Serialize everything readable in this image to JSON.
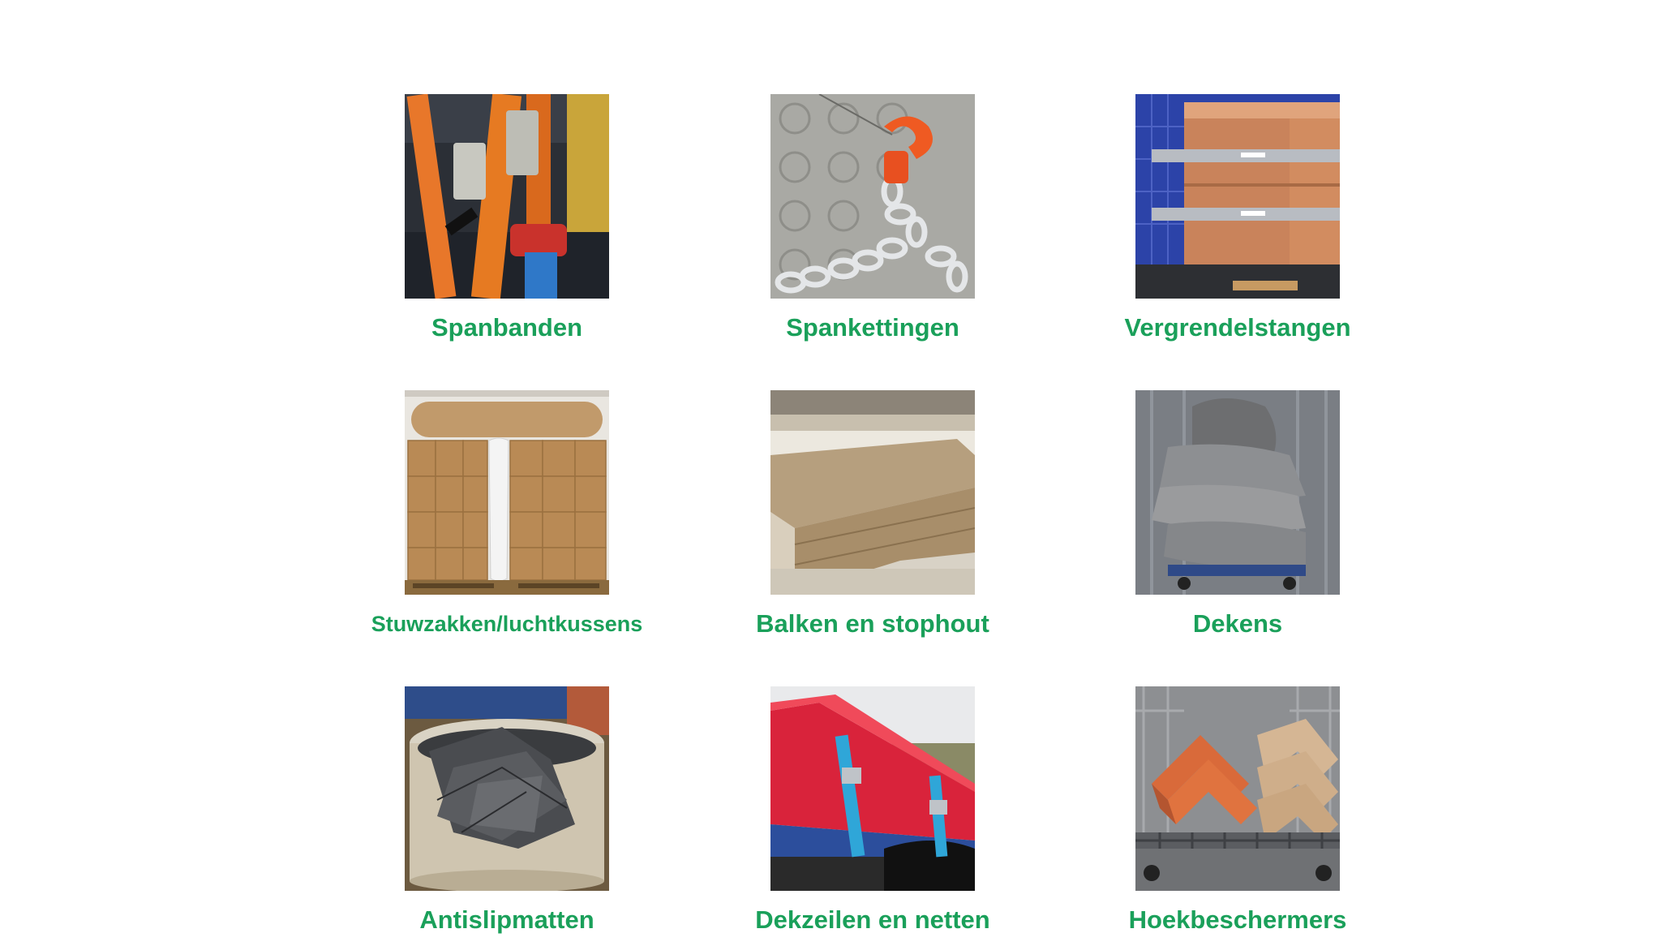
{
  "colors": {
    "label": "#1aa05a",
    "background": "#ffffff"
  },
  "categories": [
    {
      "label": "Spanbanden",
      "icon": "ratchet-strap-photo"
    },
    {
      "label": "Spankettingen",
      "icon": "chain-hook-photo"
    },
    {
      "label": "Vergrendelstangen",
      "icon": "locking-bar-photo"
    },
    {
      "label": "Stuwzakken/luchtkussens",
      "icon": "dunnage-bag-photo"
    },
    {
      "label": "Balken en stophout",
      "icon": "timber-beam-photo"
    },
    {
      "label": "Dekens",
      "icon": "moving-blanket-photo"
    },
    {
      "label": "Antislipmatten",
      "icon": "anti-slip-mat-photo"
    },
    {
      "label": "Dekzeilen en netten",
      "icon": "tarpaulin-photo"
    },
    {
      "label": "Hoekbeschermers",
      "icon": "corner-protector-photo"
    }
  ]
}
